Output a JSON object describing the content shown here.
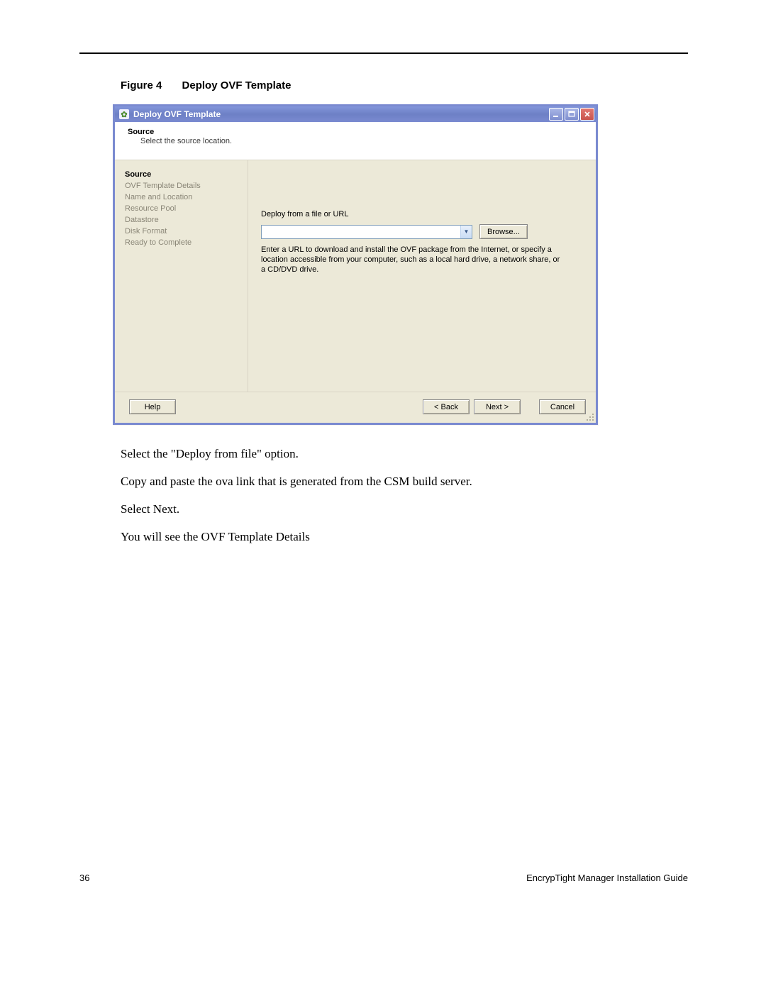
{
  "figure": {
    "label": "Figure 4",
    "title": "Deploy OVF Template"
  },
  "dialog": {
    "title": "Deploy OVF Template",
    "header": {
      "title": "Source",
      "subtitle": "Select the source location."
    },
    "steps": [
      "Source",
      "OVF Template Details",
      "Name and Location",
      "Resource Pool",
      "Datastore",
      "Disk Format",
      "Ready to Complete"
    ],
    "content": {
      "field_label": "Deploy from a file or URL",
      "input_value": "",
      "browse_label": "Browse...",
      "help_text": "Enter a URL to download and install the OVF package from the Internet, or specify a location accessible from your computer, such as a local hard drive, a network share, or a CD/DVD drive."
    },
    "buttons": {
      "help": "Help",
      "back": "< Back",
      "next": "Next >",
      "cancel": "Cancel"
    }
  },
  "body_paragraphs": [
    "Select the \"Deploy from file\" option.",
    "Copy and paste the ova link that is generated from the CSM build server.",
    "Select Next.",
    "You will see the OVF Template Details"
  ],
  "footer": {
    "page_number": "36",
    "doc_title": "EncrypTight Manager Installation Guide"
  }
}
